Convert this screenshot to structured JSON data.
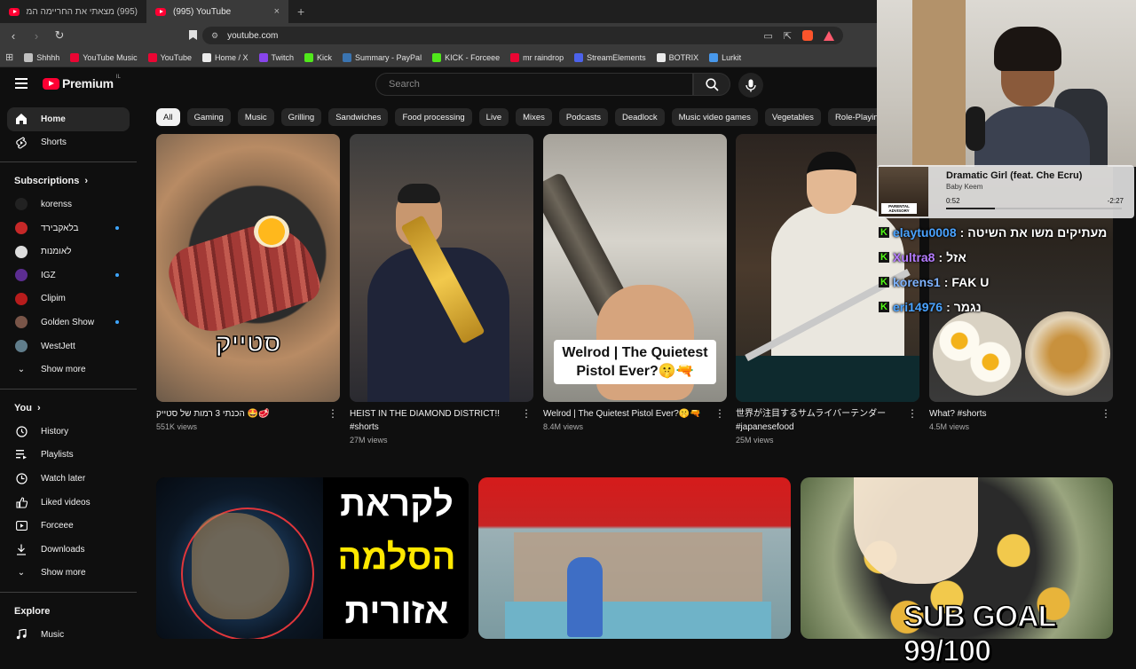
{
  "browser": {
    "tabs": [
      {
        "title": "(995) מצאתי את החריימה המושלמת.",
        "active": false
      },
      {
        "title": "(995) YouTube",
        "active": true
      }
    ],
    "new_tab": "+",
    "close": "×",
    "url": "youtube.com",
    "bookmarks": [
      {
        "label": "Shhhh",
        "icon": "folder-icon",
        "color": "#cfcfcf"
      },
      {
        "label": "YouTube Music",
        "icon": "youtube-music-icon",
        "color": "#ff0033"
      },
      {
        "label": "YouTube",
        "icon": "youtube-icon",
        "color": "#ff0033"
      },
      {
        "label": "Home / X",
        "icon": "x-icon",
        "color": "#ffffff"
      },
      {
        "label": "Twitch",
        "icon": "twitch-icon",
        "color": "#9146ff"
      },
      {
        "label": "Kick",
        "icon": "kick-icon",
        "color": "#53fc18"
      },
      {
        "label": "Summary - PayPal",
        "icon": "paypal-icon",
        "color": "#3b7bbf"
      },
      {
        "label": "KICK - Forceee",
        "icon": "kick-icon",
        "color": "#53fc18"
      },
      {
        "label": "mr raindrop",
        "icon": "youtube-icon",
        "color": "#ff0033"
      },
      {
        "label": "StreamElements",
        "icon": "streamelements-icon",
        "color": "#4f67ff"
      },
      {
        "label": "BOTRIX",
        "icon": "botrix-icon",
        "color": "#ffffff"
      },
      {
        "label": "Lurkit",
        "icon": "lurkit-icon",
        "color": "#4aa3ff"
      }
    ]
  },
  "header": {
    "logo_text": "Premium",
    "logo_country": "IL",
    "search_placeholder": "Search"
  },
  "sidebar": {
    "main": [
      {
        "label": "Home",
        "icon": "home-icon",
        "active": true
      },
      {
        "label": "Shorts",
        "icon": "shorts-icon",
        "active": false
      }
    ],
    "subscriptions_title": "Subscriptions",
    "subscriptions": [
      {
        "label": "korenss",
        "color": "#222222",
        "dot": false
      },
      {
        "label": "בלאקבירד",
        "color": "#c62828",
        "dot": true
      },
      {
        "label": "לאומנות",
        "color": "#dddddd",
        "dot": false
      },
      {
        "label": "IGZ",
        "color": "#5c2d91",
        "dot": true
      },
      {
        "label": "Clipim",
        "color": "#b71c1c",
        "dot": false
      },
      {
        "label": "Golden Show",
        "color": "#795548",
        "dot": true
      },
      {
        "label": "WestJett",
        "color": "#607d8b",
        "dot": false
      }
    ],
    "show_more": "Show more",
    "you_title": "You",
    "you_items": [
      {
        "label": "History",
        "icon": "history-icon"
      },
      {
        "label": "Playlists",
        "icon": "playlists-icon"
      },
      {
        "label": "Watch later",
        "icon": "watch-later-icon"
      },
      {
        "label": "Liked videos",
        "icon": "like-icon"
      },
      {
        "label": "Forceee",
        "icon": "your-videos-icon"
      },
      {
        "label": "Downloads",
        "icon": "download-icon"
      }
    ],
    "show_more_2": "Show more",
    "explore_title": "Explore",
    "explore_items": [
      {
        "label": "Music",
        "icon": "music-icon"
      }
    ]
  },
  "chips": [
    "All",
    "Gaming",
    "Music",
    "Grilling",
    "Sandwiches",
    "Food processing",
    "Live",
    "Mixes",
    "Podcasts",
    "Deadlock",
    "Music video games",
    "Vegetables",
    "Role-Playing"
  ],
  "shorts": [
    {
      "title": "הכנתי 3 רמות של סטייק 🤩🥩",
      "views": "551K views",
      "overlay": "סטייק"
    },
    {
      "title": "HEIST IN THE DIAMOND DISTRICT!! #shorts",
      "views": "27M views",
      "overlay": ""
    },
    {
      "title": "Welrod | The Quietest Pistol Ever?🤫🔫",
      "views": "8.4M views",
      "overlay": "Welrod | The Quietest Pistol Ever?🤫🔫"
    },
    {
      "title": "世界が注目するサムライバーテンダー #japanesefood",
      "views": "25M views",
      "overlay": ""
    },
    {
      "title": "What? #shorts",
      "views": "4.5M views",
      "overlay": ""
    }
  ],
  "videos": [
    {
      "overlay_lines": [
        "לקראת",
        "הסלמה",
        "אזורית"
      ]
    },
    {
      "overlay_lines": []
    },
    {
      "overlay_lines": []
    }
  ],
  "stream": {
    "now_playing": {
      "title": "Dramatic Girl (feat. Che Ecru)",
      "artist": "Baby Keem",
      "elapsed": "0:52",
      "remaining": "-2:27",
      "progress": 0.28,
      "art_label": "PARENTAL ADVISORY"
    },
    "chat": [
      {
        "user": "elaytu0008",
        "message": "מעתיקים משו את השיטה",
        "user_color": "#4aa3ff"
      },
      {
        "user": "Xultra8",
        "message": "אזל",
        "user_color": "#b57cff"
      },
      {
        "user": "korens1",
        "message": "FAK U",
        "user_color": "#7fb3ff"
      },
      {
        "user": "eri14976",
        "message": "נגמר",
        "user_color": "#4aa3ff"
      }
    ],
    "sub_goal": "SUB GOAL 99/100"
  }
}
